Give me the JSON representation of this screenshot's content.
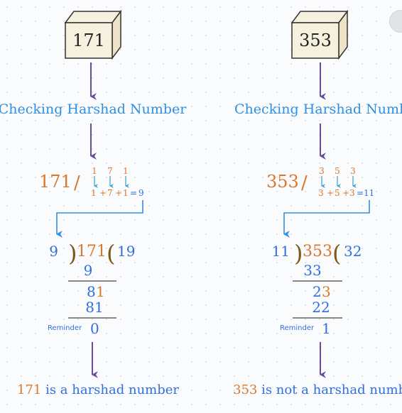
{
  "left": {
    "number": "171",
    "checking_label": "Checking Harshad Number",
    "digits": [
      "1",
      "7",
      "1"
    ],
    "sum_terms": [
      "1",
      "+",
      "7",
      "+",
      "1",
      "=",
      "9"
    ],
    "divisor": "9",
    "dividend": "171",
    "quotient": "19",
    "step1_subtract": "9",
    "step2_bring_a": "8",
    "step2_bring_b": "1",
    "step3_subtract": "81",
    "reminder_label": "Reminder",
    "remainder": "0",
    "result_number": "171",
    "result_text": " is a harshad number"
  },
  "right": {
    "number": "353",
    "checking_label": "Checking Harshad Number",
    "digits": [
      "3",
      "5",
      "3"
    ],
    "sum_terms": [
      "3",
      "+",
      "5",
      "+",
      "3",
      "=",
      "11"
    ],
    "divisor": "11",
    "dividend": "353",
    "quotient": "32",
    "step1_subtract": "33",
    "step2_bring_a": "2",
    "step2_bring_b": "3",
    "step3_subtract": "22",
    "reminder_label": "Reminder",
    "remainder": "1",
    "result_number": "353",
    "result_text": " is not a harshad number"
  },
  "colors": {
    "orange": "#d9782d",
    "blue": "#2f6fe0",
    "teal": "#3aa0c8",
    "purple": "#6a4c9c",
    "brown": "#7a5a1a",
    "cube_fill": "#f6f0de",
    "cube_stroke": "#333333"
  }
}
